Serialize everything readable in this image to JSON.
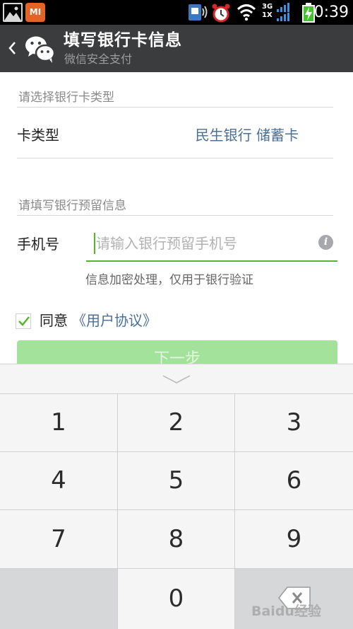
{
  "status_bar": {
    "mi_label": "MI",
    "network_top": "3G",
    "network_bottom": "1X",
    "time": "0:39",
    "icons": [
      "gallery-icon",
      "mi-app-icon",
      "sim-icon",
      "vibrate-icon",
      "alarm-icon",
      "wifi-icon",
      "signal-icon",
      "battery-charging-icon"
    ]
  },
  "title_bar": {
    "title": "填写银行卡信息",
    "subtitle": "微信安全支付",
    "icons": [
      "back-chevron-icon",
      "wechat-logo-icon"
    ]
  },
  "form": {
    "card_section_label": "请选择银行卡类型",
    "card_type_label": "卡类型",
    "card_type_value": "民生银行 储蓄卡",
    "reserved_section_label": "请填写银行预留信息",
    "phone_label": "手机号",
    "phone_value": "",
    "phone_placeholder": "请输入银行预留手机号",
    "info_icon_glyph": "i",
    "hint": "信息加密处理，仅用于银行验证",
    "agree_checked": true,
    "agree_text": "同意",
    "agreement_link": "《用户协议》",
    "next_button": "下一步"
  },
  "keyboard": {
    "keys": [
      "1",
      "2",
      "3",
      "4",
      "5",
      "6",
      "7",
      "8",
      "9",
      "0"
    ],
    "icons": [
      "collapse-keyboard-icon",
      "backspace-icon"
    ]
  },
  "watermark": "Baidu经验",
  "colors": {
    "status_bar": "#000000",
    "title_bar": "#3b3c3d",
    "accent_green": "#56b52d",
    "button_disabled_green": "#a3e29a",
    "link_blue": "#4a6f99",
    "keyboard_bg": "#cfd0d2"
  }
}
